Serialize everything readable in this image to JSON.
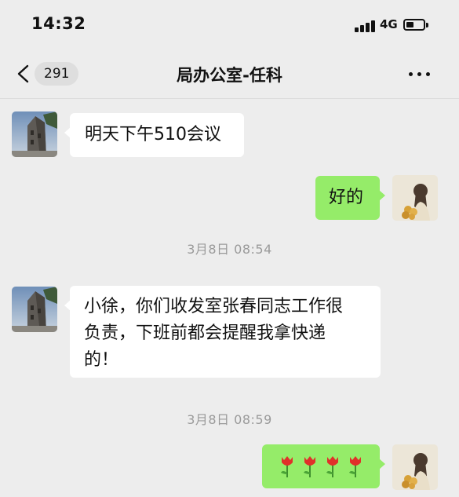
{
  "status_bar": {
    "time": "14:32",
    "network": "4G",
    "signal_icon": "cellular-signal-icon",
    "battery_icon": "battery-icon"
  },
  "nav": {
    "back_icon": "chevron-left-icon",
    "unread_count": "291",
    "title": "局办公室-任科",
    "more_icon": "more-dots-icon"
  },
  "messages": [
    {
      "side": "left",
      "sender": "局办公室-任科",
      "text": "明天下午510会议"
    },
    {
      "side": "right",
      "sender": "me",
      "text": "好的"
    },
    {
      "type": "timestamp",
      "text": "3月8日 08:54"
    },
    {
      "side": "left",
      "sender": "局办公室-任科",
      "lines": [
        "小徐，你们收发室张春同志工作很",
        "负责，下班前都会提醒我拿快递",
        "的！"
      ]
    },
    {
      "type": "timestamp",
      "text": "3月8日 08:59"
    },
    {
      "side": "right",
      "sender": "me",
      "emoji": [
        "tulip",
        "tulip",
        "tulip",
        "tulip"
      ]
    }
  ],
  "colors": {
    "background": "#ededed",
    "incoming_bubble": "#ffffff",
    "outgoing_bubble": "#95ec69",
    "timestamp_text": "#9a9a9a"
  }
}
